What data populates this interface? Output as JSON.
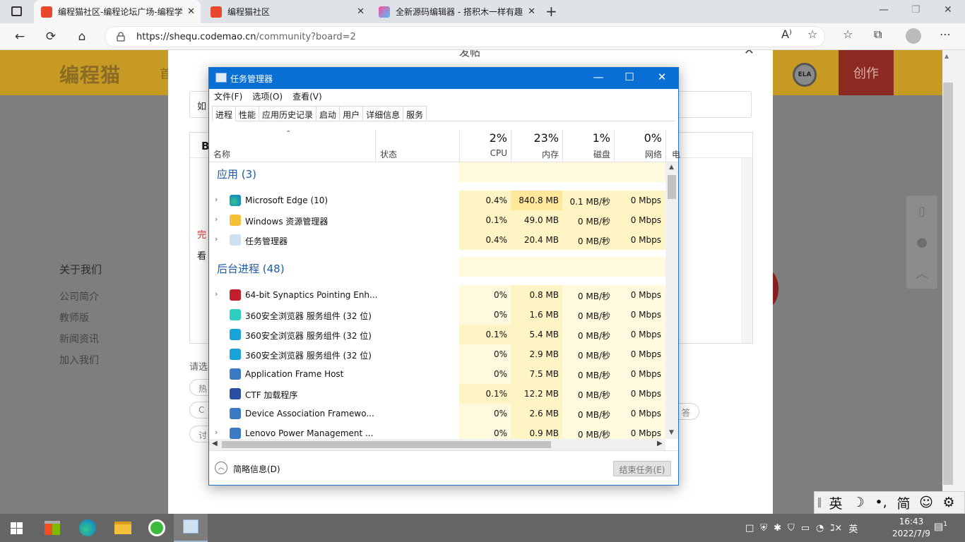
{
  "browser": {
    "tabs": [
      {
        "title": "编程猫社区-编程论坛广场-编程学",
        "active": true
      },
      {
        "title": "编程猫社区",
        "active": false
      },
      {
        "title": "全新源码编辑器 - 搭积木一样有趣",
        "active": false
      }
    ],
    "new_tab_glyph": "+",
    "window_controls": [
      "—",
      "❐",
      "✕"
    ],
    "url_host": "https://shequ.codemao.cn",
    "url_path": "/community?board=2",
    "toolbar_icons": [
      "read-aloud-icon",
      "add-favorite-icon",
      "favorites-icon",
      "collections-icon",
      "profile-icon",
      "more-icon"
    ]
  },
  "site": {
    "logo": "编程猫",
    "nav_first": "首",
    "ela_badge": "ELA",
    "create_button": "创作",
    "footer_heading": "关于我们",
    "footer_links": [
      "公司简介",
      "教师版",
      "新闻资讯",
      "加入我们"
    ],
    "modal": {
      "title": "发帖",
      "title_input_value": "如",
      "editor_bold": "B",
      "editor_done_text": "完",
      "editor_watch_text": "看",
      "select_tip": "请选",
      "pill_texts": [
        "热",
        "C",
        "讨",
        "答"
      ]
    }
  },
  "ime": [
    "英",
    "☽",
    "•,",
    "简",
    "☺",
    "⚙"
  ],
  "taskmanager": {
    "title": "任务管理器",
    "menu": [
      "文件(F)",
      "选项(O)",
      "查看(V)"
    ],
    "tabs": [
      "进程",
      "性能",
      "应用历史记录",
      "启动",
      "用户",
      "详细信息",
      "服务"
    ],
    "columns": {
      "name": "名称",
      "status": "状态",
      "cpu": {
        "pct": "2%",
        "label": "CPU"
      },
      "mem": {
        "pct": "23%",
        "label": "内存"
      },
      "disk": {
        "pct": "1%",
        "label": "磁盘"
      },
      "net": {
        "pct": "0%",
        "label": "网络"
      },
      "power_partial": "电"
    },
    "groups": [
      {
        "name": "应用 (3)",
        "rows": [
          {
            "name": "Microsoft Edge (10)",
            "icon": "edge-icon",
            "expand": true,
            "cpu": "0.4%",
            "mem": "840.8 MB",
            "disk": "0.1 MB/秒",
            "net": "0 Mbps",
            "heat": [
              "y1",
              "y2",
              "y1",
              "y1"
            ]
          },
          {
            "name": "Windows 资源管理器",
            "icon": "folder-icon",
            "expand": true,
            "cpu": "0.1%",
            "mem": "49.0 MB",
            "disk": "0 MB/秒",
            "net": "0 Mbps",
            "heat": [
              "y1",
              "y1",
              "y1",
              "y1"
            ]
          },
          {
            "name": "任务管理器",
            "icon": "taskmanager-icon",
            "expand": true,
            "cpu": "0.4%",
            "mem": "20.4 MB",
            "disk": "0 MB/秒",
            "net": "0 Mbps",
            "heat": [
              "y1",
              "y1",
              "y1",
              "y1"
            ]
          }
        ]
      },
      {
        "name": "后台进程 (48)",
        "rows": [
          {
            "name": "64-bit Synaptics Pointing Enh...",
            "icon": "synaptics-icon",
            "expand": true,
            "cpu": "0%",
            "mem": "0.8 MB",
            "disk": "0 MB/秒",
            "net": "0 Mbps",
            "heat": [
              "y0",
              "y1",
              "y0",
              "y0"
            ]
          },
          {
            "name": "360安全浏览器 服务组件 (32 位)",
            "icon": "360-service-icon",
            "expand": false,
            "cpu": "0%",
            "mem": "1.6 MB",
            "disk": "0 MB/秒",
            "net": "0 Mbps",
            "heat": [
              "y0",
              "y1",
              "y0",
              "y0"
            ]
          },
          {
            "name": "360安全浏览器 服务组件 (32 位)",
            "icon": "360-browser-icon",
            "expand": false,
            "cpu": "0.1%",
            "mem": "5.4 MB",
            "disk": "0 MB/秒",
            "net": "0 Mbps",
            "heat": [
              "y1",
              "y1",
              "y0",
              "y0"
            ]
          },
          {
            "name": "360安全浏览器 服务组件 (32 位)",
            "icon": "360-browser-icon",
            "expand": false,
            "cpu": "0%",
            "mem": "2.9 MB",
            "disk": "0 MB/秒",
            "net": "0 Mbps",
            "heat": [
              "y0",
              "y1",
              "y0",
              "y0"
            ]
          },
          {
            "name": "Application Frame Host",
            "icon": "app-frame-icon",
            "expand": false,
            "cpu": "0%",
            "mem": "7.5 MB",
            "disk": "0 MB/秒",
            "net": "0 Mbps",
            "heat": [
              "y0",
              "y1",
              "y0",
              "y0"
            ]
          },
          {
            "name": "CTF 加载程序",
            "icon": "ctf-icon",
            "expand": false,
            "cpu": "0.1%",
            "mem": "12.2 MB",
            "disk": "0 MB/秒",
            "net": "0 Mbps",
            "heat": [
              "y1",
              "y1",
              "y0",
              "y0"
            ]
          },
          {
            "name": "Device Association Framewo...",
            "icon": "app-frame-icon",
            "expand": false,
            "cpu": "0%",
            "mem": "2.6 MB",
            "disk": "0 MB/秒",
            "net": "0 Mbps",
            "heat": [
              "y0",
              "y1",
              "y0",
              "y0"
            ]
          },
          {
            "name": "Lenovo Power Management ...",
            "icon": "app-frame-icon",
            "expand": true,
            "cpu": "0%",
            "mem": "0.9 MB",
            "disk": "0 MB/秒",
            "net": "0 Mbps",
            "heat": [
              "y0",
              "y1",
              "y0",
              "y0"
            ]
          }
        ]
      }
    ],
    "fewer_details": "简略信息(D)",
    "end_task": "结束任务(E)"
  },
  "taskbar": {
    "tray": [
      "□",
      "⛨",
      "✱",
      "⛉",
      "▭",
      "◔",
      "ℷ×",
      "英"
    ],
    "time": "16:43",
    "date": "2022/7/9",
    "notification_count": "1"
  }
}
